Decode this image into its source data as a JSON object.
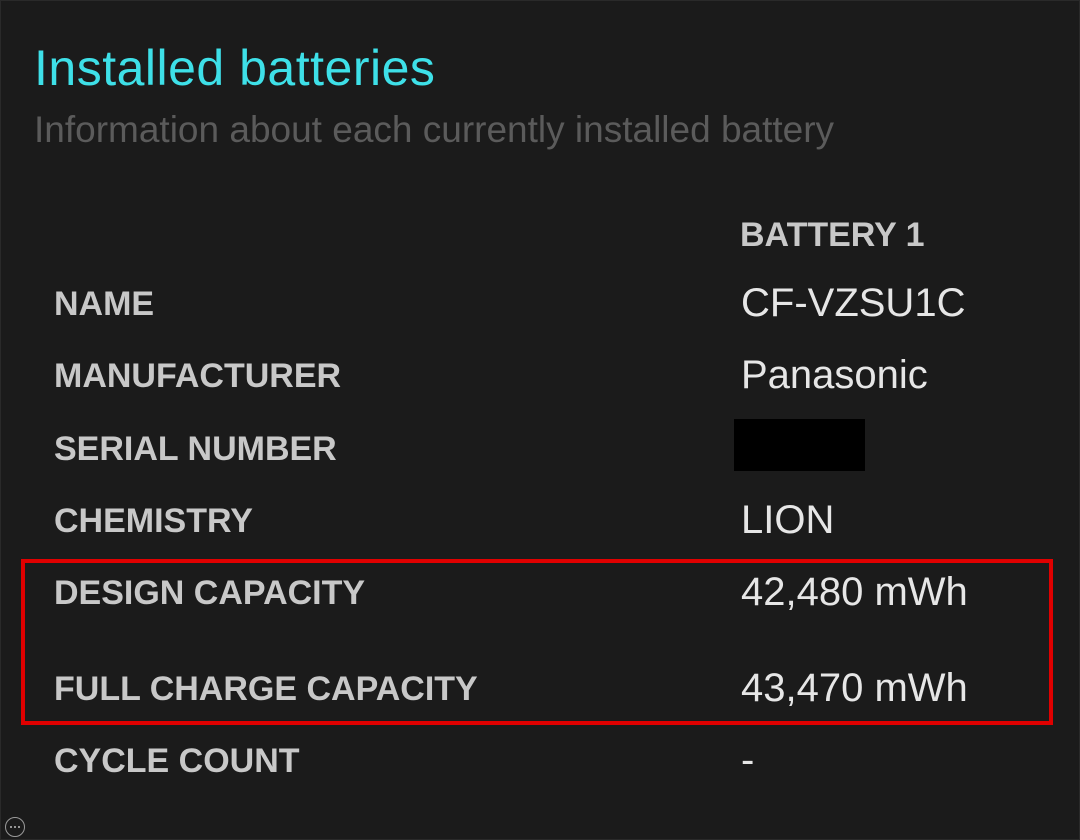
{
  "section": {
    "title": "Installed batteries",
    "subtitle": "Information about each currently installed battery"
  },
  "battery_table": {
    "column_header": "BATTERY 1",
    "rows": [
      {
        "label": "NAME",
        "value": "CF-VZSU1C"
      },
      {
        "label": "MANUFACTURER",
        "value": "Panasonic"
      },
      {
        "label": "SERIAL NUMBER",
        "value": ""
      },
      {
        "label": "CHEMISTRY",
        "value": "LION"
      },
      {
        "label": "DESIGN CAPACITY",
        "value": "42,480 mWh"
      },
      {
        "label": "FULL CHARGE CAPACITY",
        "value": "43,470 mWh"
      },
      {
        "label": "CYCLE COUNT",
        "value": "-"
      }
    ]
  },
  "annotation": {
    "highlight_color": "#e00000"
  },
  "colors": {
    "background": "#1b1b1b",
    "title": "#3ee0e8",
    "subtitle": "#5b5b5b",
    "label": "#c8c8c8",
    "value": "#e6e6e6"
  },
  "icons": {
    "more": "more-options-icon"
  }
}
